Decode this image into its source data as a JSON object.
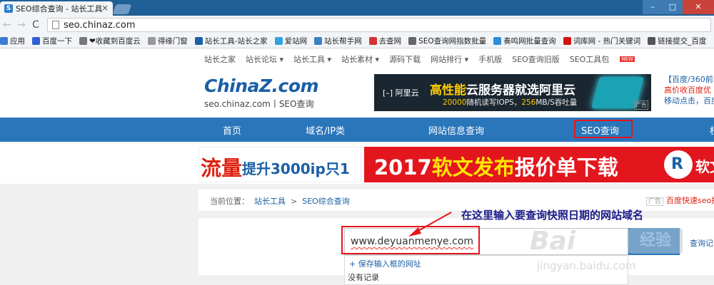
{
  "browser": {
    "tab_title": "SEO综合查询 - 站长工具",
    "tab_close": "×",
    "address": "seo.chinaz.com",
    "nav_back": "←",
    "nav_forward": "→",
    "nav_reload": "C",
    "bookmarks": [
      {
        "label": "应用",
        "color": "#3a7bd5"
      },
      {
        "label": "百度一下",
        "color": "#2f5fd0"
      },
      {
        "label": "❤收藏到百度云",
        "color": "#777777"
      },
      {
        "label": "得缘门窗",
        "color": "#999999"
      },
      {
        "label": "站长工具-站长之家",
        "color": "#1b5fa5"
      },
      {
        "label": "爱站网",
        "color": "#33a0e0"
      },
      {
        "label": "站长帮手网",
        "color": "#3b7fc4"
      },
      {
        "label": "去查网",
        "color": "#d33333"
      },
      {
        "label": "SEO查询网指数批量",
        "color": "#666666"
      },
      {
        "label": "奏鸣网批量查询",
        "color": "#2b8fd9"
      },
      {
        "label": "词库网 - 热门关键词",
        "color": "#d21111"
      },
      {
        "label": "链接提交_百度",
        "color": "#555555"
      }
    ]
  },
  "toplinks": [
    "站长之家",
    "站长论坛 ▾",
    "站长工具 ▾",
    "站长素材 ▾",
    "源码下载",
    "网站排行 ▾",
    "手机版",
    "SEO查询旧版",
    "SEO工具包"
  ],
  "toplinks_new_badge": "NEW",
  "logo": {
    "brand_a": "China",
    "brand_z": "Z",
    "brand_b": ".com",
    "sub": "seo.chinaz.com丨SEO查询"
  },
  "ad_top": {
    "vendor": "阿里云",
    "headline_pre": "高性能",
    "headline_post": "云服务器就选阿里云",
    "spec_a": "20000",
    "spec_b": "随机读写IOPS，",
    "spec_c": "256",
    "spec_d": "MB/S吞吐量",
    "tag": "广告"
  },
  "side_ad": {
    "line1": "【百度/360前5",
    "line2": "高价收百度优",
    "line3": "移动点击，百度"
  },
  "nav": [
    "首页",
    "域名/IP类",
    "网站信息查询",
    "SEO查询",
    "权"
  ],
  "banner": {
    "left_big": "流量",
    "left_small": "提升3000ip只1元",
    "right_year": "2017",
    "right_a": "软文发布",
    "right_b": "报价单下载",
    "right_logo": "R",
    "right_tail": "软文"
  },
  "breadcrumb": {
    "prefix": "当前位置：",
    "item1": "站长工具",
    "sep": ">",
    "item2": "SEO综合查询"
  },
  "crumb_ad": {
    "tag": "广告",
    "text": "百度快速seo排"
  },
  "annotation": "在这里输入要查询快照日期的网站域名",
  "search": {
    "value": "www.deyuanmenye.com",
    "history_link": "查询记录"
  },
  "dropdown": {
    "save_link": "+ 保存输入框的网址",
    "empty": "没有记录"
  },
  "watermark": {
    "bai": "Bai",
    "jingyan": "经验",
    "url": "jingyan.baidu.com"
  }
}
